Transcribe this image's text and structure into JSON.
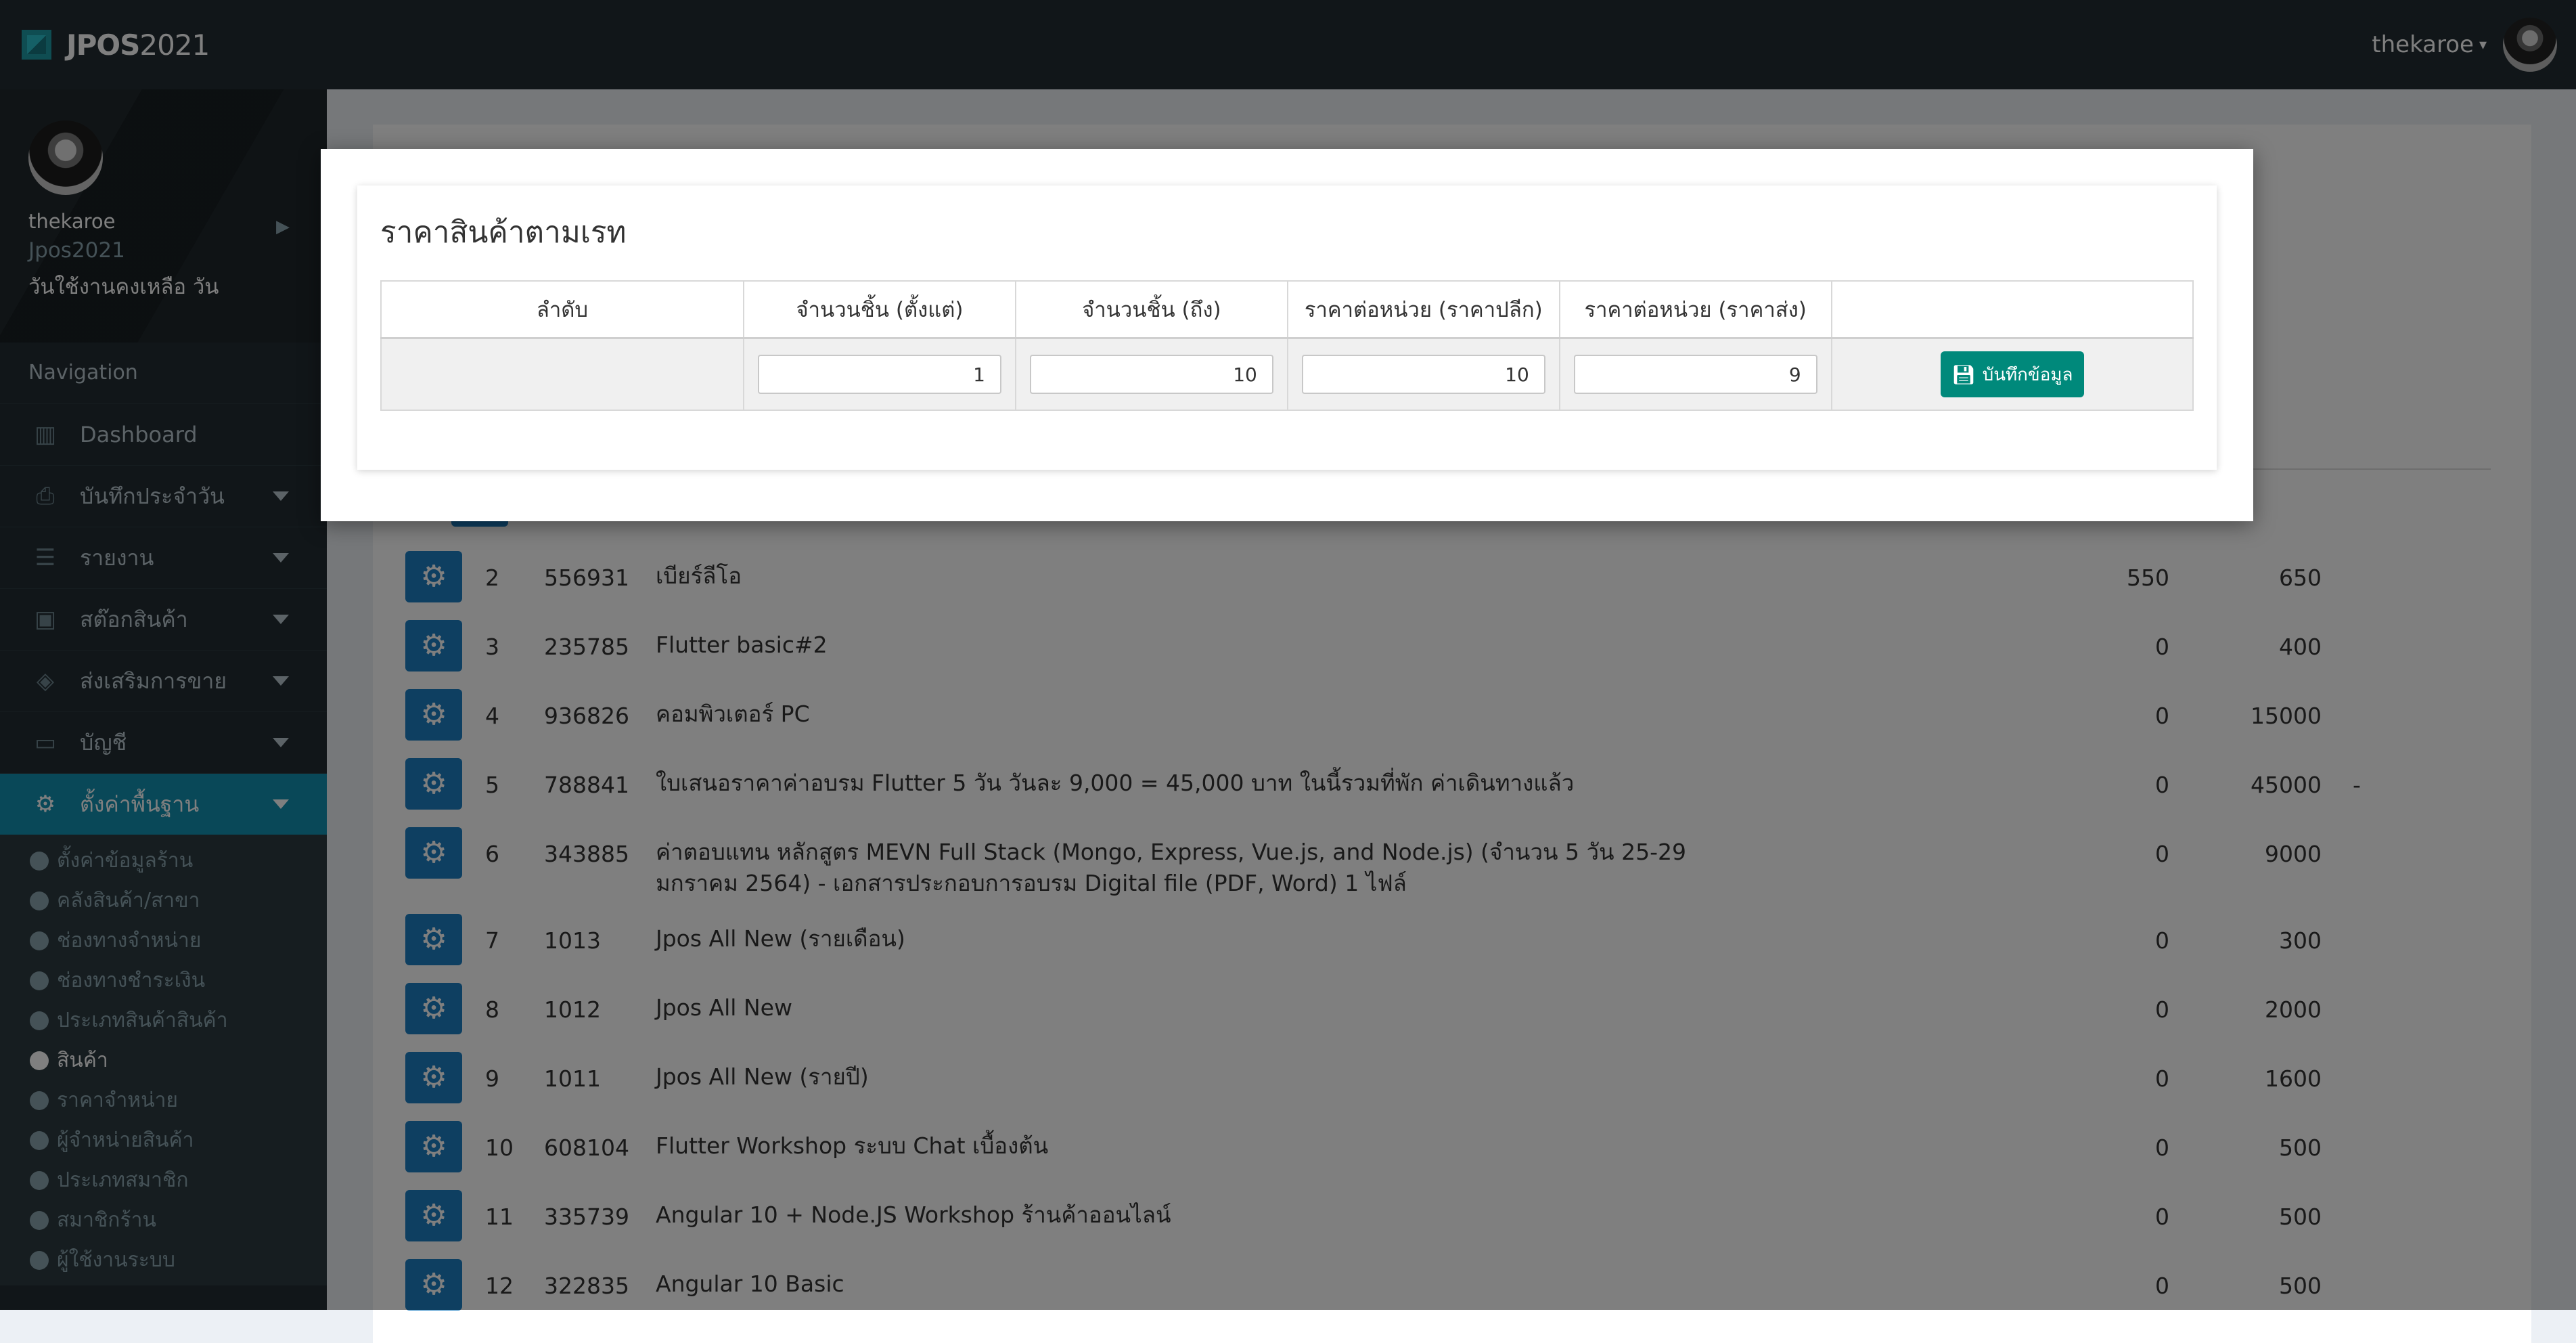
{
  "app": {
    "brand_bold": "JPOS",
    "brand_light": "2021",
    "user_name": "thekaroe"
  },
  "sidebar": {
    "user": {
      "name": "thekaroe",
      "shop": "Jpos2021",
      "days_left": "วันใช้งานคงเหลือ วัน"
    },
    "nav_header": "Navigation",
    "items": [
      {
        "label": "Dashboard",
        "icon": "chart-icon"
      },
      {
        "label": "บันทึกประจำวัน",
        "icon": "printer-icon"
      },
      {
        "label": "รายงาน",
        "icon": "report-icon"
      },
      {
        "label": "สต๊อกสินค้า",
        "icon": "stock-icon"
      },
      {
        "label": "ส่งเสริมการขาย",
        "icon": "promo-icon"
      },
      {
        "label": "บัญชี",
        "icon": "laptop-icon"
      },
      {
        "label": "ตั้งค่าพื้นฐาน",
        "icon": "gear-icon"
      }
    ],
    "submenu": [
      "ตั้งค่าข้อมูลร้าน",
      "คลังสินค้า/สาขา",
      "ช่องทางจำหน่าย",
      "ช่องทางชำระเงิน",
      "ประเภทสินค้าสินค้า",
      "สินค้า",
      "ราคาจำหน่าย",
      "ผู้จำหน่ายสินค้า",
      "ประเภทสมาชิก",
      "สมาชิกร้าน",
      "ผู้ใช้งานระบบ"
    ]
  },
  "products": [
    {
      "no": "2",
      "code": "556931",
      "name": "เบียร์ลีโอ",
      "cost": "550",
      "price": "650",
      "extra": ""
    },
    {
      "no": "3",
      "code": "235785",
      "name": "Flutter basic#2",
      "cost": "0",
      "price": "400",
      "extra": ""
    },
    {
      "no": "4",
      "code": "936826",
      "name": "คอมพิวเตอร์ PC",
      "cost": "0",
      "price": "15000",
      "extra": ""
    },
    {
      "no": "5",
      "code": "788841",
      "name": "ใบเสนอราคาค่าอบรม Flutter 5 วัน วันละ 9,000 = 45,000 บาท ในนี้รวมที่พัก ค่าเดินทางแล้ว",
      "cost": "0",
      "price": "45000",
      "extra": "-"
    },
    {
      "no": "6",
      "code": "343885",
      "name": "ค่าตอบแทน หลักสูตร MEVN Full Stack (Mongo, Express, Vue.js, and Node.js) (จำนวน 5 วัน 25-29 มกราคม 2564) - เอกสารประกอบการอบรม Digital file (PDF, Word) 1 ไฟล์",
      "cost": "0",
      "price": "9000",
      "extra": ""
    },
    {
      "no": "7",
      "code": "1013",
      "name": "Jpos All New (รายเดือน)",
      "cost": "0",
      "price": "300",
      "extra": ""
    },
    {
      "no": "8",
      "code": "1012",
      "name": "Jpos All New",
      "cost": "0",
      "price": "2000",
      "extra": ""
    },
    {
      "no": "9",
      "code": "1011",
      "name": "Jpos All New (รายปี)",
      "cost": "0",
      "price": "1600",
      "extra": ""
    },
    {
      "no": "10",
      "code": "608104",
      "name": "Flutter Workshop ระบบ Chat เบื้องต้น",
      "cost": "0",
      "price": "500",
      "extra": ""
    },
    {
      "no": "11",
      "code": "335739",
      "name": "Angular 10 + Node.JS Workshop ร้านค้าออนไลน์",
      "cost": "0",
      "price": "500",
      "extra": ""
    },
    {
      "no": "12",
      "code": "322835",
      "name": "Angular 10 Basic",
      "cost": "0",
      "price": "500",
      "extra": ""
    }
  ],
  "modal": {
    "title": "ราคาสินค้าตามเรท",
    "headers": [
      "ลำดับ",
      "จำนวนชิ้น (ตั้งแต่)",
      "จำนวนชิ้น (ถึง)",
      "ราคาต่อหน่วย (ราคาปลีก)",
      "ราคาต่อหน่วย (ราคาส่ง)",
      ""
    ],
    "row": {
      "order": "",
      "qty_from": "1",
      "qty_to": "10",
      "retail_price": "10",
      "wholesale_price": "9"
    },
    "save_label": "บันทึกข้อมูล"
  },
  "colors": {
    "topbar": "#222d32",
    "sidebar_active": "#1390b0",
    "gear_button": "#1c7ec3",
    "save_button": "#00897b"
  }
}
